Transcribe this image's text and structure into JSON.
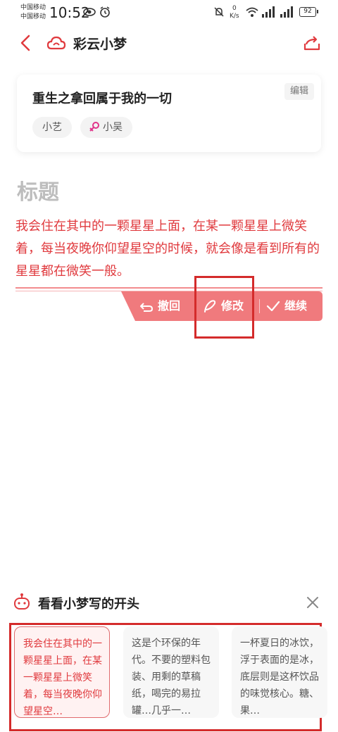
{
  "status_bar": {
    "carrier_1": "中国移动",
    "carrier_2": "中国移动",
    "time": "10:52",
    "net_speed_value": "0",
    "net_speed_unit": "K/s",
    "battery": "92"
  },
  "nav": {
    "title": "彩云小梦"
  },
  "story_card": {
    "title": "重生之拿回属于我的一切",
    "edit_label": "编辑",
    "roles": [
      "小艺",
      "小吴"
    ]
  },
  "editor": {
    "heading_placeholder": "标题",
    "text": "我会住在其中的一颗星星上面，在某一颗星星上微笑着，每当夜晚你仰望星空的时候，就会像是看到所有的星星都在微笑一般。"
  },
  "actions": {
    "undo": "撤回",
    "modify": "修改",
    "continue": "继续"
  },
  "suggestions": {
    "title": "看看小梦写的开头",
    "items": [
      "我会住在其中的一颗星星上面，在某一颗星星上微笑着，每当夜晚你仰望星空…",
      "这是个环保的年代。不要的塑料包装、用剩的草稿纸，喝完的易拉罐…几乎一…",
      "一杯夏日的冰饮，浮于表面的是冰，底层则是这杯饮品的味觉核心。糖、果…"
    ]
  },
  "colors": {
    "accent": "#e03a3e",
    "action_bar": "#f07a7d",
    "highlight_box": "#d42b2b"
  }
}
